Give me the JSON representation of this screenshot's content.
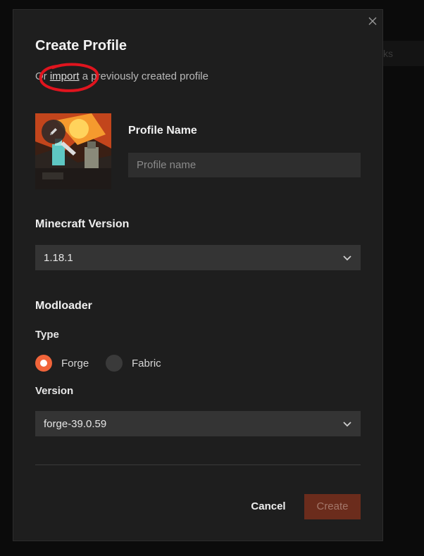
{
  "background": {
    "partial_text": "ks"
  },
  "modal": {
    "title": "Create Profile",
    "subtitle": {
      "prefix": "Or",
      "link": "import",
      "suffix": "a previously created profile"
    },
    "close_icon": "close-icon",
    "profile_image": {
      "edit_icon": "pencil-icon"
    },
    "profile_name": {
      "label": "Profile Name",
      "placeholder": "Profile name",
      "value": ""
    },
    "minecraft_version": {
      "label": "Minecraft Version",
      "selected": "1.18.1",
      "icon": "chevron-down-icon"
    },
    "modloader": {
      "label": "Modloader",
      "type_label": "Type",
      "options": [
        {
          "label": "Forge",
          "selected": true
        },
        {
          "label": "Fabric",
          "selected": false
        }
      ],
      "version_label": "Version",
      "version_selected": "forge-39.0.59"
    },
    "actions": {
      "cancel": "Cancel",
      "create": "Create"
    }
  },
  "annotation": {
    "color": "#e0141e",
    "shape": "hand-drawn circle around import link"
  },
  "colors": {
    "accent": "#f0643a",
    "create_disabled_bg": "#6b2c1c",
    "modal_bg": "#1e1e1e"
  }
}
